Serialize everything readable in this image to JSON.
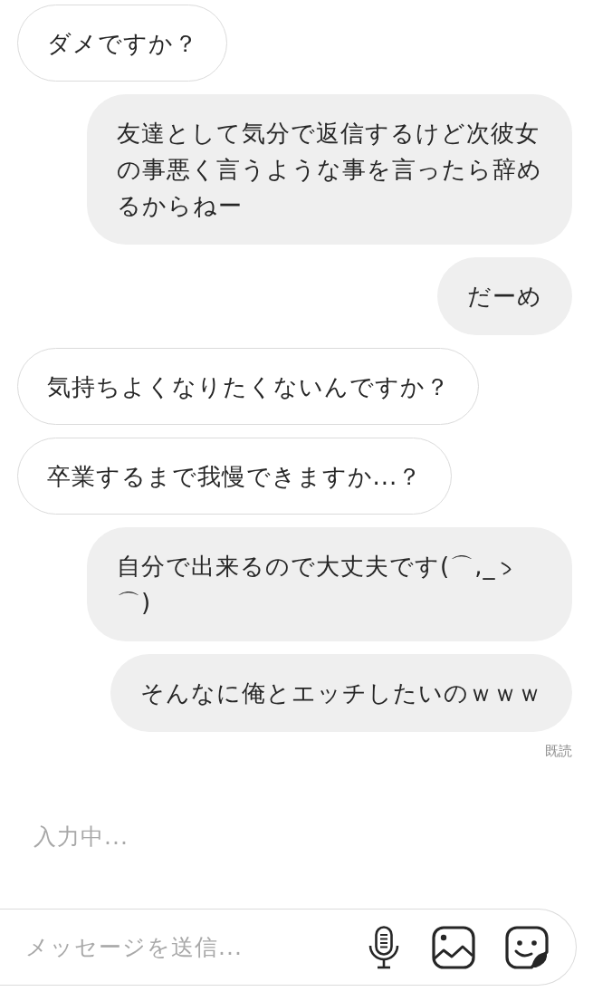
{
  "messages": [
    {
      "kind": "received",
      "text": "ダメですか？"
    },
    {
      "kind": "sent",
      "text": "友達として気分で返信するけど次彼女の事悪く言うような事を言ったら辞めるからねー"
    },
    {
      "kind": "sent",
      "text": "だーめ"
    },
    {
      "kind": "received",
      "text": "気持ちよくなりたくないんですか？"
    },
    {
      "kind": "received",
      "text": "卒業するまで我慢できますか...？"
    },
    {
      "kind": "sent",
      "segments": [
        {
          "kind": "text",
          "text": "自分で出来るので大丈夫です(⌒,_"
        },
        {
          "kind": "icon"
        },
        {
          "kind": "text",
          "text": "⌒)"
        }
      ]
    },
    {
      "kind": "sent",
      "text": "そんなに俺とエッチしたいのｗｗｗ"
    }
  ],
  "read_receipt": "既読",
  "typing_indicator": "入力中...",
  "composer": {
    "placeholder": "メッセージを送信..."
  }
}
